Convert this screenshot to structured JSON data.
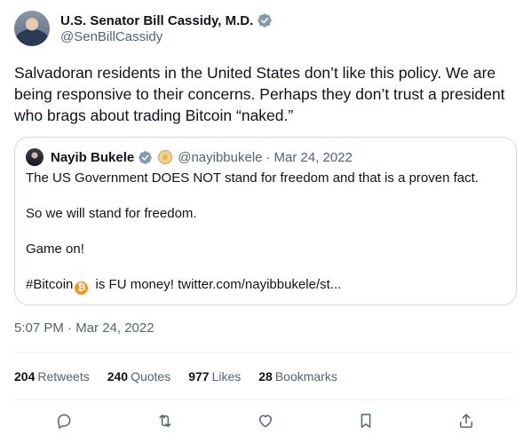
{
  "author": {
    "display_name": "U.S. Senator Bill Cassidy, M.D.",
    "handle": "@SenBillCassidy",
    "verified_icon": "verified-badge-icon",
    "verified_color": "#829aab"
  },
  "tweet": {
    "text": "Salvadoran residents in the United States don’t like this policy. We are being responsive to their concerns. Perhaps they don’t trust a president who brags about trading Bitcoin “naked.”"
  },
  "quote": {
    "display_name": "Nayib Bukele",
    "handle": "@nayibbukele",
    "separator": "·",
    "date": "Mar 24, 2022",
    "lines": [
      "The US Government DOES NOT stand for freedom and that is a proven fact.",
      "So we will stand for freedom.",
      "Game on!"
    ],
    "last_line_prefix": "#Bitcoin",
    "bitcoin_icon": "bitcoin-icon",
    "bitcoin_color": "#f7931a",
    "last_line_suffix": "is FU money! twitter.com/nayibbukele/st..."
  },
  "timestamp": "5:07 PM · Mar 24, 2022",
  "stats": [
    {
      "value": "204",
      "label": "Retweets"
    },
    {
      "value": "240",
      "label": "Quotes"
    },
    {
      "value": "977",
      "label": "Likes"
    },
    {
      "value": "28",
      "label": "Bookmarks"
    }
  ],
  "actions": [
    "reply-icon",
    "retweet-icon",
    "like-icon",
    "bookmark-icon",
    "share-icon"
  ],
  "colors": {
    "text": "#0f1419",
    "secondary": "#536471",
    "border": "#cfd9de",
    "divider": "#eff3f4"
  }
}
